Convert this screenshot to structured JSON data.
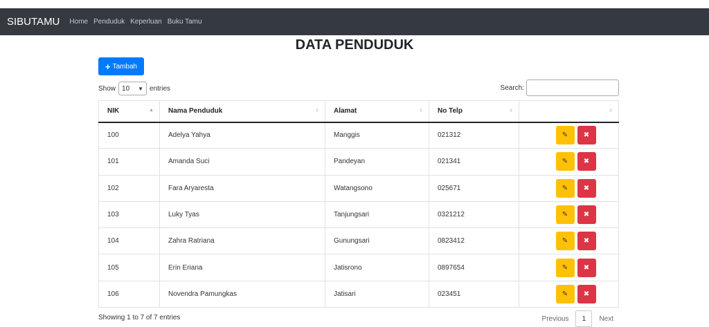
{
  "navbar": {
    "brand": "SIBUTAMU",
    "links": [
      "Home",
      "Penduduk",
      "Keperluan",
      "Buku Tamu"
    ]
  },
  "page_title": "DATA PENDUDUK",
  "add_button": {
    "icon": "plus-icon",
    "label": "Tambah"
  },
  "length": {
    "prefix": "Show",
    "value": "10",
    "suffix": "entries"
  },
  "search": {
    "label": "Search:",
    "value": ""
  },
  "table": {
    "headers": [
      "NIK",
      "Nama Penduduk",
      "Alamat",
      "No Telp",
      ""
    ],
    "rows": [
      {
        "nik": "100",
        "nama": "Adelya Yahya",
        "alamat": "Manggis",
        "telp": "021312"
      },
      {
        "nik": "101",
        "nama": "Amanda Suci",
        "alamat": "Pandeyan",
        "telp": "021341"
      },
      {
        "nik": "102",
        "nama": "Fara Aryaresta",
        "alamat": "Watangsono",
        "telp": "025671"
      },
      {
        "nik": "103",
        "nama": "Luky Tyas",
        "alamat": "Tanjungsari",
        "telp": "0321212"
      },
      {
        "nik": "104",
        "nama": "Zahra Ratriana",
        "alamat": "Gunungsari",
        "telp": "0823412"
      },
      {
        "nik": "105",
        "nama": "Erin Eriana",
        "alamat": "Jatisrono",
        "telp": "0897654"
      },
      {
        "nik": "106",
        "nama": "Novendra Pamungkas",
        "alamat": "Jatisari",
        "telp": "023451"
      }
    ]
  },
  "footer": {
    "info": "Showing 1 to 7 of 7 entries",
    "previous": "Previous",
    "page": "1",
    "next": "Next"
  },
  "colors": {
    "navbar": "#343a40",
    "primary": "#007bff",
    "warning": "#ffc107",
    "danger": "#dc3545"
  }
}
